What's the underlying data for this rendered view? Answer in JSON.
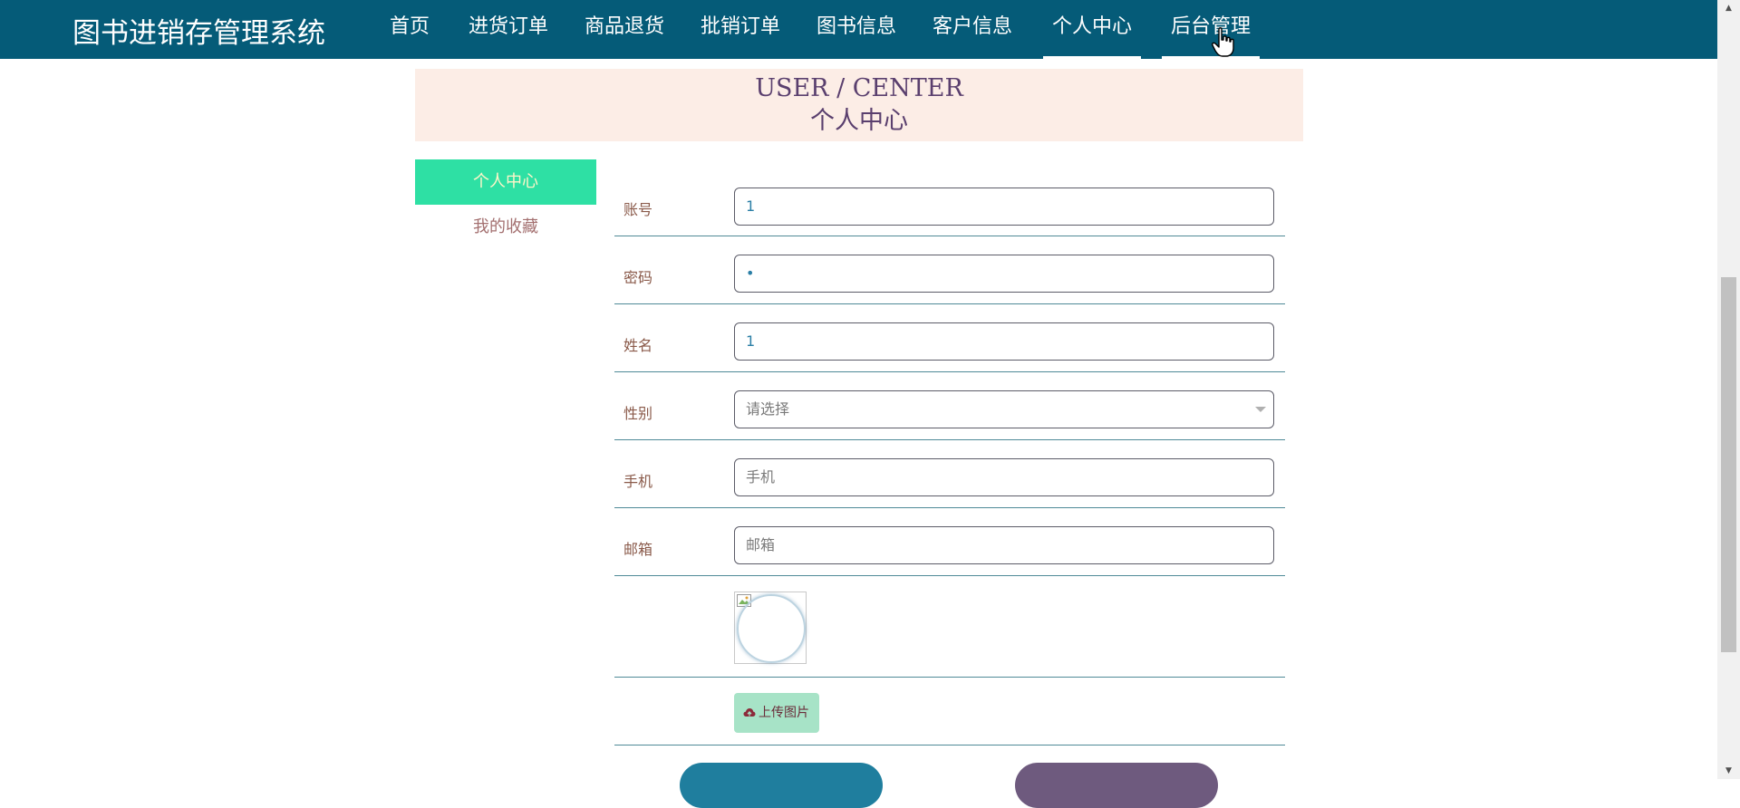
{
  "header": {
    "brand": "图书进销存管理系统",
    "nav": [
      {
        "label": "首页"
      },
      {
        "label": "进货订单"
      },
      {
        "label": "商品退货"
      },
      {
        "label": "批销订单"
      },
      {
        "label": "图书信息"
      },
      {
        "label": "客户信息"
      },
      {
        "label": "个人中心",
        "active": true
      },
      {
        "label": "后台管理",
        "hover": true
      }
    ]
  },
  "banner": {
    "en": "USER / CENTER",
    "cn": "个人中心"
  },
  "sidebar": {
    "items": [
      {
        "label": "个人中心",
        "active": true
      },
      {
        "label": "我的收藏"
      }
    ]
  },
  "form": {
    "account": {
      "label": "账号",
      "value": "1"
    },
    "password": {
      "label": "密码",
      "value": "•"
    },
    "name": {
      "label": "姓名",
      "value": "1"
    },
    "gender": {
      "label": "性别",
      "selected": "请选择"
    },
    "phone": {
      "label": "手机",
      "placeholder": "手机"
    },
    "email": {
      "label": "邮箱",
      "placeholder": "邮箱"
    },
    "upload_label": "上传图片"
  },
  "colors": {
    "topbar": "#055b78",
    "sidebar_active": "#2ee0a4",
    "banner_bg": "#fcede6",
    "upload_button": "#a7e3c7",
    "save_button": "#1f7e9e",
    "logout_button": "#6e5a7e"
  },
  "icons": {
    "cursor": "hand-pointer-icon",
    "upload": "cloud-upload-icon",
    "select": "chevron-down-icon",
    "avatar": "broken-image-icon"
  }
}
